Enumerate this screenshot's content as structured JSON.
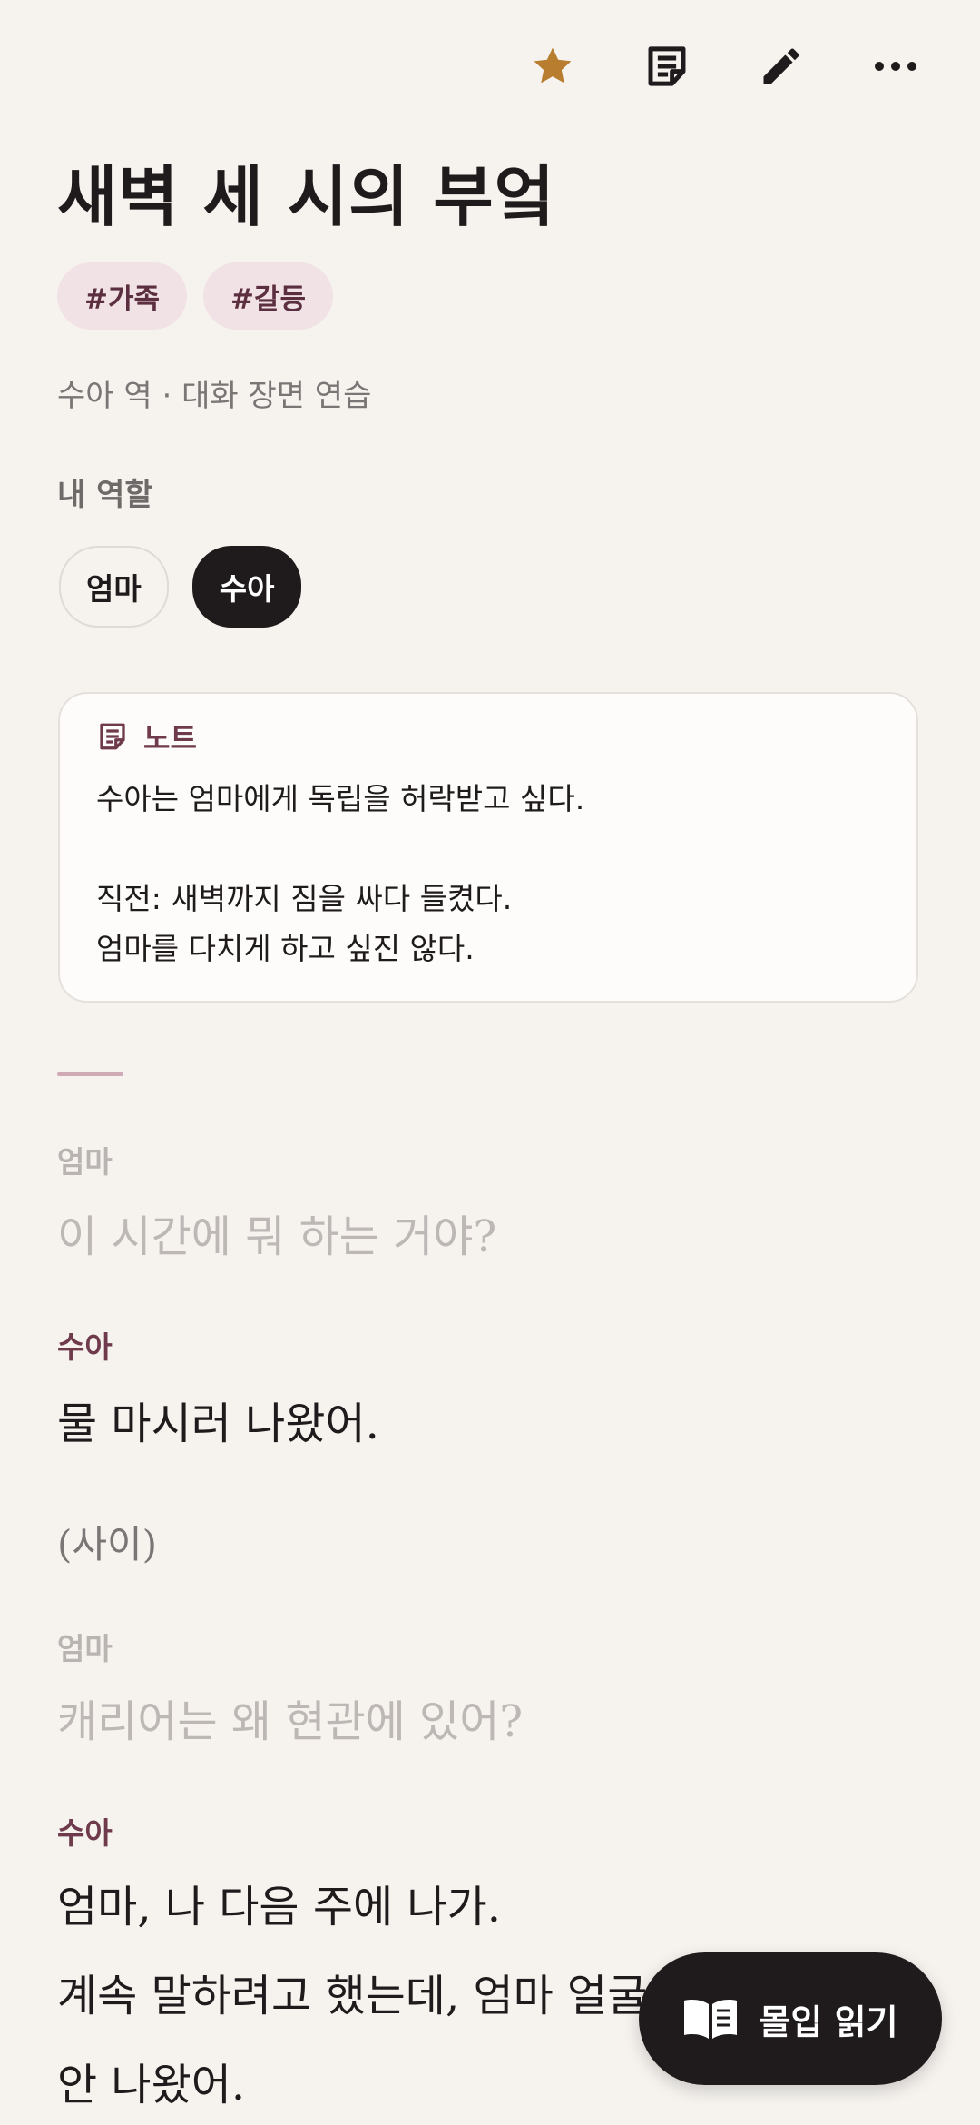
{
  "toolbar": {
    "icons": [
      "star-icon",
      "notes-icon",
      "edit-icon",
      "more-icon"
    ],
    "accent_color": "#b87d2e"
  },
  "scene": {
    "title": "새벽 세 시의 부엌",
    "tags": [
      "#가족",
      "#갈등"
    ],
    "subtitle": "수아 역 · 대화 장면 연습"
  },
  "roles": {
    "label": "내 역할",
    "options": [
      "엄마",
      "수아"
    ],
    "selected": "수아"
  },
  "note": {
    "title": "노트",
    "body": "수아는 엄마에게 독립을 허락받고 싶다.\n\n직전: 새벽까지 짐을 싸다 들켰다.\n엄마를 다치게 하고 싶진 않다."
  },
  "script": [
    {
      "speaker": "엄마",
      "text": "이 시간에 뭐 하는 거야?"
    },
    {
      "speaker": "수아",
      "text": "물 마시러 나왔어."
    },
    {
      "stage": "(사이)"
    },
    {
      "speaker": "엄마",
      "text": "캐리어는 왜 현관에 있어?"
    },
    {
      "speaker": "수아",
      "lines": [
        "엄마, 나 다음 주에 나가.",
        "계속 말하려고 했는데, 엄마 얼굴",
        "안 나왔어."
      ]
    }
  ],
  "fab": {
    "label": "몰입 읽기",
    "icon": "open-book-icon"
  }
}
